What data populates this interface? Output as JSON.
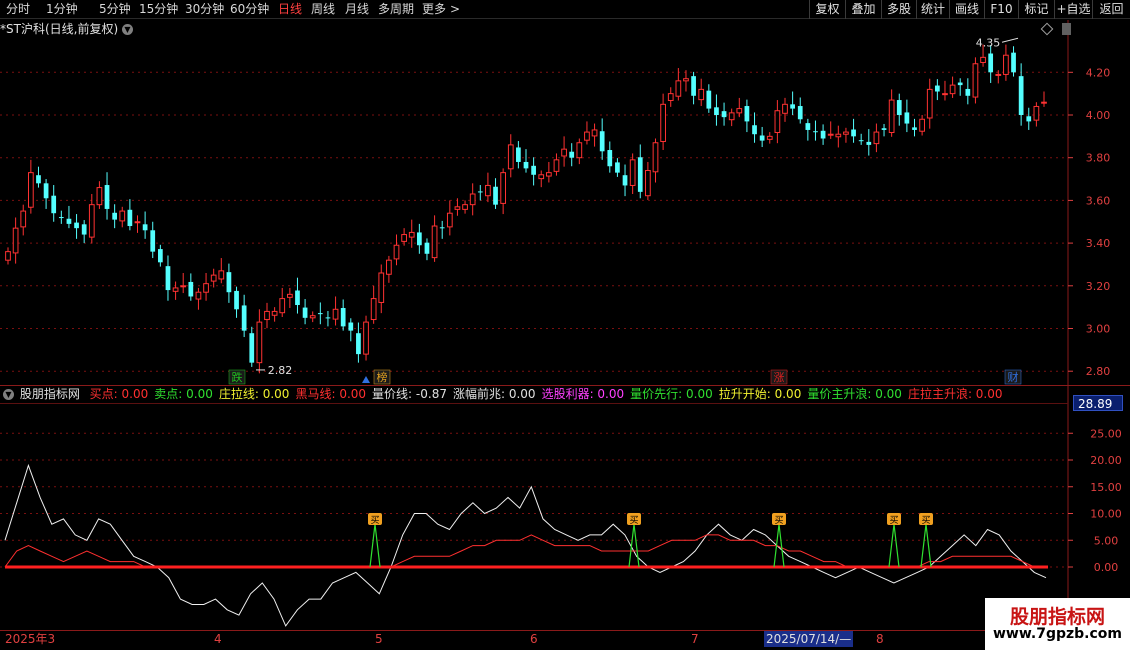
{
  "toolbar": {
    "periods": [
      "分时",
      "1分钟",
      "5分钟",
      "15分钟",
      "30分钟",
      "60分钟",
      "日线",
      "周线",
      "月线",
      "多周期",
      "更多"
    ],
    "more_arrow": ">",
    "active_period": "日线",
    "right_buttons": [
      "复权",
      "叠加",
      "多股",
      "统计",
      "画线",
      "F10",
      "标记",
      "+自选",
      "返回"
    ]
  },
  "price_panel": {
    "title": "*ST沪科",
    "subtitle": "(日线,前复权)",
    "high_label": "4.35",
    "low_label": "2.82",
    "y_ticks": [
      "4.20",
      "4.00",
      "3.80",
      "3.60",
      "3.40",
      "3.20",
      "3.00",
      "2.80"
    ],
    "events": [
      {
        "label": "跌",
        "color": "#20c020"
      },
      {
        "label": "榜",
        "color": "#e0a020"
      },
      {
        "label": "涨",
        "color": "#e02020"
      },
      {
        "label": "财",
        "color": "#3070e0"
      }
    ]
  },
  "indicator_panel": {
    "name": "股朋指标网",
    "fields": [
      {
        "label": "买点:",
        "value": "0.00",
        "color": "#ff3030"
      },
      {
        "label": "卖点:",
        "value": "0.00",
        "color": "#30e030"
      },
      {
        "label": "庄拉线:",
        "value": "0.00",
        "color": "#f0f030"
      },
      {
        "label": "黑马线:",
        "value": "0.00",
        "color": "#ff3030"
      },
      {
        "label": "量价线:",
        "value": "-0.87",
        "color": "#e0e0e0"
      },
      {
        "label": "涨幅前兆:",
        "value": "0.00",
        "color": "#e0e0e0"
      },
      {
        "label": "选股利器:",
        "value": "0.00",
        "color": "#ff40ff"
      },
      {
        "label": "量价先行:",
        "value": "0.00",
        "color": "#30e030"
      },
      {
        "label": "拉升开始:",
        "value": "0.00",
        "color": "#f0f030"
      },
      {
        "label": "量价主升浪:",
        "value": "0.00",
        "color": "#30e030"
      },
      {
        "label": "庄拉主升浪:",
        "value": "0.00",
        "color": "#ff3030"
      }
    ],
    "current_value": "28.89",
    "y_ticks": [
      "25.00",
      "20.00",
      "15.00",
      "10.00",
      "5.00",
      "0.00"
    ],
    "signal_mark": "买"
  },
  "time_axis": {
    "labels": [
      "2025年3",
      "4",
      "5",
      "6",
      "7",
      "2025/07/14/—",
      "8"
    ]
  },
  "watermark": {
    "title": "股朋指标网",
    "url": "www.7gpzb.com"
  },
  "colors": {
    "up": "#ff3232",
    "down": "#54ffff",
    "grid": "#7a1010",
    "axis_text": "#e04040"
  }
}
